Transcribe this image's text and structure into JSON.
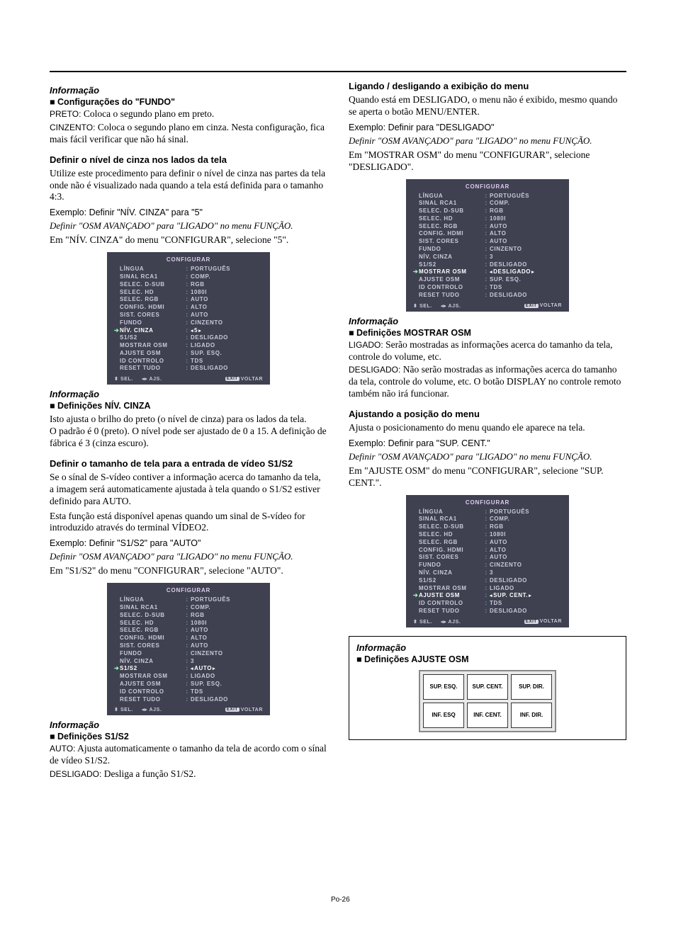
{
  "pagenum": "Po-26",
  "left": {
    "info1_head": "Informação",
    "info1_sub": "Configurações do \"FUNDO\"",
    "info1_body_a_lead": "PRETO:",
    "info1_body_a": " Coloca o segundo plano em preto.",
    "info1_body_b_lead": "CINZENTO:",
    "info1_body_b": " Coloca o segundo plano em cinza. Nesta configuração, fica mais fácil verificar que não há sinal.",
    "sect1_head": "Definir o nível de cinza nos lados da tela",
    "sect1_body": "Utilize este procedimento para definir o nível de cinza nas partes da tela onde não é visualizado nada quando a tela está definida para o tamanho 4:3.",
    "sect1_ex": "Exemplo: Definir \"NÍV. CINZA\" para \"5\"",
    "sect1_it": "Definir \"OSM AVANÇADO\" para \"LIGADO\" no menu FUNÇÃO.",
    "sect1_note": "Em \"NÍV. CINZA\" do menu \"CONFIGURAR\", selecione \"5\".",
    "info2_head": "Informação",
    "info2_sub": "Definições NÍV. CINZA",
    "info2_body": "Isto ajusta o brilho do preto (o nível de cinza) para os lados da tela.\nO padrão é 0 (preto). O nível pode ser ajustado de 0 a 15. A definição de fábrica é 3 (cinza escuro).",
    "sect2_head": "Definir o tamanho de tela para a entrada de vídeo S1/S2",
    "sect2_body1": "Se o sínal de S-vídeo contiver a informação acerca do tamanho da tela, a imagem será automaticamente ajustada à tela quando o S1/S2 estiver definido para AUTO.",
    "sect2_body2": "Esta função está disponível apenas quando um sinal de S-vídeo for introduzido através do terminal VÍDEO2.",
    "sect2_ex": "Exemplo: Definir \"S1/S2\" para \"AUTO\"",
    "sect2_it": "Definir \"OSM AVANÇADO\" para \"LIGADO\" no menu FUNÇÃO.",
    "sect2_note": "Em \"S1/S2\" do menu \"CONFIGURAR\", selecione \"AUTO\".",
    "info3_head": "Informação",
    "info3_sub": "Definições S1/S2",
    "info3_body_a_lead": "AUTO:",
    "info3_body_a": " Ajusta automaticamente o tamanho da tela de acordo com o sínal de vídeo S1/S2.",
    "info3_body_b_lead": "DESLIGADO:",
    "info3_body_b": " Desliga a função S1/S2."
  },
  "right": {
    "sect3_head": "Ligando / desligando a exibição do menu",
    "sect3_body": "Quando está em DESLIGADO, o menu não é exibido, mesmo quando se aperta o botão MENU/ENTER.",
    "sect3_ex": "Exemplo: Definir para \"DESLIGADO\"",
    "sect3_it": "Definir \"OSM AVANÇADO\" para \"LIGADO\" no menu FUNÇÃO.",
    "sect3_note": "Em \"MOSTRAR OSM\" do menu \"CONFIGURAR\", selecione \"DESLIGADO\".",
    "info4_head": "Informação",
    "info4_sub": "Definições MOSTRAR OSM",
    "info4_body_a_lead": "LIGADO:",
    "info4_body_a": " Serão mostradas as informações acerca do tamanho da tela, controle do volume, etc.",
    "info4_body_b_lead": "DESLIGADO:",
    "info4_body_b": " Não serão mostradas as informações acerca do tamanho da tela, controle do volume, etc. O botão DISPLAY no controle remoto também não irá funcionar.",
    "sect4_head": "Ajustando a posição do menu",
    "sect4_body": "Ajusta o posicionamento do menu quando ele aparece na tela.",
    "sect4_ex": "Exemplo: Definir para \"SUP. CENT.\"",
    "sect4_it": "Definir \"OSM AVANÇADO\" para \"LIGADO\" no menu FUNÇÃO.",
    "sect4_note": "Em \"AJUSTE OSM\" do menu \"CONFIGURAR\", selecione \"SUP. CENT.\".",
    "info5_head": "Informação",
    "info5_sub": "Definições AJUSTE OSM",
    "cells": [
      "SUP. ESQ.",
      "SUP. CENT.",
      "SUP. DIR.",
      "INF. ESQ",
      "INF. CENT.",
      "INF. DIR."
    ]
  },
  "osd_title": "CONFIGURAR",
  "osd_rows_common": [
    {
      "label": "LÍNGUA",
      "val": "PORTUGUÊS"
    },
    {
      "label": "SINAL RCA1",
      "val": "COMP."
    },
    {
      "label": "SELEC. D-SUB",
      "val": "RGB"
    },
    {
      "label": "SELEC. HD",
      "val": "1080I"
    },
    {
      "label": "SELEC. RGB",
      "val": "AUTO"
    },
    {
      "label": "CONFIG. HDMI",
      "val": "ALTO"
    },
    {
      "label": "SIST. CORES",
      "val": "AUTO"
    },
    {
      "label": "FUNDO",
      "val": "CINZENTO"
    }
  ],
  "osd1_rest": [
    {
      "label": "NÍV. CINZA",
      "val": "5",
      "hl": true,
      "arrow": true,
      "brkt": true
    },
    {
      "label": "S1/S2",
      "val": "DESLIGADO"
    },
    {
      "label": "MOSTRAR OSM",
      "val": "LIGADO"
    },
    {
      "label": "AJUSTE OSM",
      "val": "SUP. ESQ."
    },
    {
      "label": "ID CONTROLO",
      "val": "TDS"
    },
    {
      "label": "RESET TUDO",
      "val": "DESLIGADO"
    }
  ],
  "osd2_rest": [
    {
      "label": "NÍV. CINZA",
      "val": "3"
    },
    {
      "label": "S1/S2",
      "val": "AUTO",
      "hl": true,
      "arrow": true,
      "brkt": true
    },
    {
      "label": "MOSTRAR OSM",
      "val": "LIGADO"
    },
    {
      "label": "AJUSTE OSM",
      "val": "SUP. ESQ."
    },
    {
      "label": "ID CONTROLO",
      "val": "TDS"
    },
    {
      "label": "RESET TUDO",
      "val": "DESLIGADO"
    }
  ],
  "osd3_rest": [
    {
      "label": "NÍV. CINZA",
      "val": "3"
    },
    {
      "label": "S1/S2",
      "val": "DESLIGADO"
    },
    {
      "label": "MOSTRAR OSM",
      "val": "DESLIGADO",
      "hl": true,
      "arrow": true,
      "brkt": true
    },
    {
      "label": "AJUSTE OSM",
      "val": "SUP. ESQ."
    },
    {
      "label": "ID CONTROLO",
      "val": "TDS"
    },
    {
      "label": "RESET TUDO",
      "val": "DESLIGADO"
    }
  ],
  "osd4_rest": [
    {
      "label": "NÍV. CINZA",
      "val": "3"
    },
    {
      "label": "S1/S2",
      "val": "DESLIGADO"
    },
    {
      "label": "MOSTRAR OSM",
      "val": "LIGADO"
    },
    {
      "label": "AJUSTE OSM",
      "val": "SUP. CENT.",
      "hl": true,
      "arrow": true,
      "brkt": true
    },
    {
      "label": "ID CONTROLO",
      "val": "TDS"
    },
    {
      "label": "RESET TUDO",
      "val": "DESLIGADO"
    }
  ],
  "osd_footer": {
    "sel": "SEL.",
    "ajs": "AJS.",
    "exit": "EXIT",
    "voltar": "VOLTAR"
  }
}
